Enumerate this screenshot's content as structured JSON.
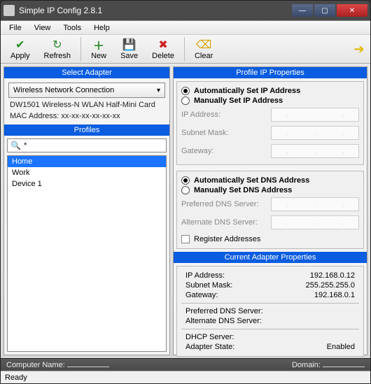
{
  "window": {
    "title": "Simple IP Config 2.8.1"
  },
  "menu": {
    "file": "File",
    "view": "View",
    "tools": "Tools",
    "help": "Help"
  },
  "toolbar": {
    "apply": "Apply",
    "refresh": "Refresh",
    "new": "New",
    "save": "Save",
    "delete": "Delete",
    "clear": "Clear"
  },
  "left": {
    "adapter_hdr": "Select Adapter",
    "adapter_selected": "Wireless Network Connection",
    "adapter_desc": "DW1501 Wireless-N WLAN Half-Mini Card",
    "mac_label": "MAC Address: xx-xx-xx-xx-xx-xx",
    "profiles_hdr": "Profiles",
    "search_text": "*",
    "items": [
      {
        "label": "Home",
        "selected": true
      },
      {
        "label": "Work",
        "selected": false
      },
      {
        "label": "Device 1",
        "selected": false
      }
    ]
  },
  "right": {
    "hdr": "Profile IP Properties",
    "ip_auto": "Automatically Set IP Address",
    "ip_manual": "Manually Set IP Address",
    "ip_addr": "IP Address:",
    "subnet": "Subnet Mask:",
    "gateway": "Gateway:",
    "dns_auto": "Automatically Set DNS Address",
    "dns_manual": "Manually Set DNS Address",
    "pref_dns": "Preferred DNS Server:",
    "alt_dns": "Alternate DNS Server:",
    "register": "Register Addresses",
    "cur_hdr": "Current Adapter Properties",
    "cur": {
      "ip_k": "IP Address:",
      "ip_v": "192.168.0.12",
      "sm_k": "Subnet Mask:",
      "sm_v": "255.255.255.0",
      "gw_k": "Gateway:",
      "gw_v": "192.168.0.1",
      "pd_k": "Preferred DNS Server:",
      "pd_v": "",
      "ad_k": "Alternate DNS Server:",
      "ad_v": "",
      "dhcp_k": "DHCP Server:",
      "dhcp_v": "",
      "state_k": "Adapter State:",
      "state_v": "Enabled"
    }
  },
  "status": {
    "computer": "Computer Name:",
    "domain": "Domain:",
    "ready": "Ready"
  }
}
